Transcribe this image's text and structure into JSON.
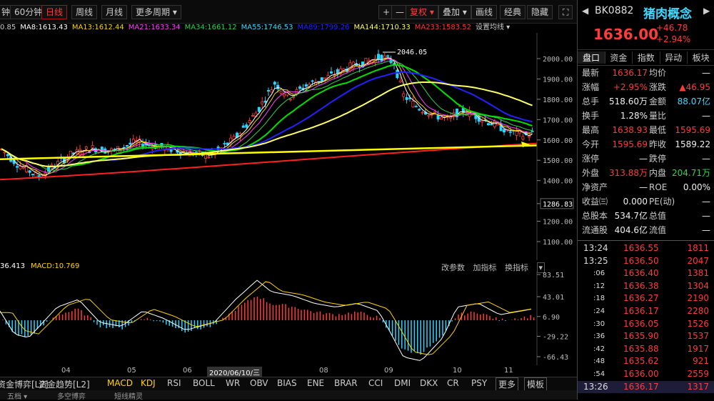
{
  "toolbar": {
    "items": [
      "钟",
      "60分钟",
      "日线",
      "周线",
      "月线",
      "更多周期 ▾"
    ],
    "right_items": [
      "+",
      "—",
      "复权 ▾",
      "叠加 ▾",
      "画线",
      "经典",
      "隐藏",
      "⛶"
    ]
  },
  "ma_legend": [
    {
      "text": "0.85",
      "color": "#cccccc"
    },
    {
      "text": "MA8:1613.43",
      "color": "#ffffff"
    },
    {
      "text": "MA13:1612.44",
      "color": "#ffd400"
    },
    {
      "text": "MA21:1633.34",
      "color": "#ff40ff"
    },
    {
      "text": "MA34:1661.12",
      "color": "#2bd54b"
    },
    {
      "text": "MA55:1746.53",
      "color": "#3fd9ff"
    },
    {
      "text": "MA89:1799.26",
      "color": "#2222ff"
    },
    {
      "text": "MA144:1710.33",
      "color": "#ffff66"
    },
    {
      "text": "MA233:1583.52",
      "color": "#ff3b3b"
    },
    {
      "text": "设置均线 ▾",
      "color": "#cccccc"
    }
  ],
  "price_axis": [
    "2000.00",
    "1900.00",
    "1800.00",
    "1700.00",
    "1600.00",
    "1500.00",
    "1400.00",
    "1286.83",
    "1200.00",
    "1100.00"
  ],
  "peak_label": "2046.05",
  "macd": {
    "legend": [
      {
        "text": "36.413",
        "color": "#ffffff"
      },
      {
        "text": "MACD:10.769",
        "color": "#ffd400"
      }
    ],
    "tools": [
      "改参数",
      "加指标",
      "换指标"
    ],
    "axis": [
      "83.51",
      "43.01",
      "6.90",
      "-29.22",
      "-66.43"
    ]
  },
  "date_axis": [
    "04",
    "05",
    "06",
    "2020/06/10/三",
    "08",
    "09",
    "10",
    "11"
  ],
  "bottom_tabs": [
    "资金博弈[L2]",
    "资金趋势[L2]",
    "MACD",
    "KDJ",
    "RSI",
    "BOLL",
    "WR",
    "OBV",
    "BIAS",
    "ENE",
    "BRAR",
    "CCI",
    "DMI",
    "DKX",
    "CR",
    "PSY",
    "更多",
    "模板"
  ],
  "status_strip": [
    "五档 ▾",
    "多空博弈",
    "短线精灵"
  ],
  "panel": {
    "code": "BK0882",
    "name": "猪肉概念",
    "price": "1636.00",
    "change": "+46.78",
    "change_pct": "+2.94%",
    "tabs": [
      "盘口",
      "资金",
      "指数",
      "异动",
      "板块"
    ],
    "rows": [
      {
        "l1": "最新",
        "v1": "1636.17",
        "c1": "up",
        "l2": "均价",
        "v2": "—",
        "c2": "wht"
      },
      {
        "l1": "涨幅",
        "v1": "+2.95%",
        "c1": "up",
        "l2": "涨跌",
        "v2": "▲46.95",
        "c2": "up"
      },
      {
        "l1": "总手",
        "v1": "518.60万",
        "c1": "wht",
        "l2": "金额",
        "v2": "88.07亿",
        "c2": "cyan"
      },
      {
        "l1": "换手",
        "v1": "1.28%",
        "c1": "wht",
        "l2": "量比",
        "v2": "—",
        "c2": "wht"
      },
      {
        "l1": "最高",
        "v1": "1638.93",
        "c1": "up",
        "l2": "最低",
        "v2": "1595.69",
        "c2": "up"
      },
      {
        "l1": "今开",
        "v1": "1595.69",
        "c1": "up",
        "l2": "昨收",
        "v2": "1589.22",
        "c2": "wht"
      },
      {
        "l1": "涨停",
        "v1": "—",
        "c1": "wht",
        "l2": "跌停",
        "v2": "—",
        "c2": "wht"
      },
      {
        "l1": "外盘",
        "v1": "313.88万",
        "c1": "up",
        "l2": "内盘",
        "v2": "204.71万",
        "c2": "grn"
      },
      {
        "l1": "净资产",
        "v1": "—",
        "c1": "wht",
        "l2": "ROE",
        "v2": "0.00%",
        "c2": "wht"
      },
      {
        "l1": "收益㈢",
        "v1": "0.000",
        "c1": "wht",
        "l2": "PE(动)",
        "v2": "—",
        "c2": "wht"
      },
      {
        "l1": "总股本",
        "v1": "534.7亿",
        "c1": "wht",
        "l2": "总值",
        "v2": "—",
        "c2": "wht"
      },
      {
        "l1": "流通股",
        "v1": "404.6亿",
        "c1": "wht",
        "l2": "流值",
        "v2": "—",
        "c2": "wht"
      }
    ],
    "ticks": [
      {
        "t": "13:24",
        "p": "1636.55",
        "v": "1811"
      },
      {
        "t": "13:25",
        "p": "1636.50",
        "v": "2047"
      },
      {
        "t": ":06",
        "p": "1636.40",
        "v": "1381"
      },
      {
        "t": ":12",
        "p": "1636.38",
        "v": "1304"
      },
      {
        "t": ":18",
        "p": "1636.27",
        "v": "2190"
      },
      {
        "t": ":24",
        "p": "1636.17",
        "v": "2280"
      },
      {
        "t": ":30",
        "p": "1636.05",
        "v": "1526"
      },
      {
        "t": ":36",
        "p": "1635.90",
        "v": "1537"
      },
      {
        "t": ":42",
        "p": "1635.88",
        "v": "1917"
      },
      {
        "t": ":48",
        "p": "1635.62",
        "v": "921"
      },
      {
        "t": ":54",
        "p": "1636.00",
        "v": "2559"
      },
      {
        "t": "13:26",
        "p": "1636.17",
        "v": "1317"
      }
    ]
  },
  "colors": {
    "up": "#ff3b3b",
    "down": "#2bd4ff",
    "bg": "#000000",
    "accent": "#ffd400"
  }
}
